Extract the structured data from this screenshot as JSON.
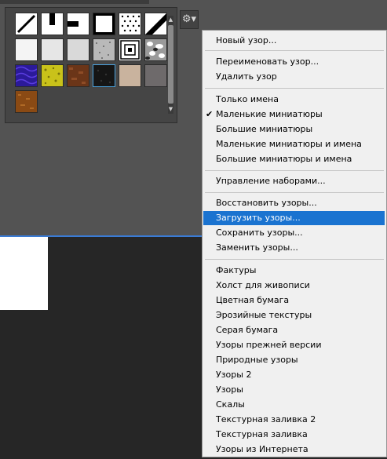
{
  "panel": {
    "gear_icon": "⚙▾",
    "scroll_up_icon": "▲",
    "scroll_down_icon": "▼"
  },
  "swatches": [
    {
      "name": "diagonal-line-pattern"
    },
    {
      "name": "vertical-bar-pattern"
    },
    {
      "name": "horizontal-bar-pattern"
    },
    {
      "name": "white-square-pattern"
    },
    {
      "name": "dot-grid-pattern"
    },
    {
      "name": "diagonal-dark-pattern"
    },
    {
      "name": "white-noise-pattern"
    },
    {
      "name": "light-gray-noise-pattern"
    },
    {
      "name": "gray-noise-pattern"
    },
    {
      "name": "dark-noise-pattern"
    },
    {
      "name": "concentric-squares-pattern"
    },
    {
      "name": "black-white-stone-pattern"
    },
    {
      "name": "blue-purple-pattern"
    },
    {
      "name": "yellow-texture-pattern"
    },
    {
      "name": "brown-texture-pattern"
    },
    {
      "name": "black-texture-pattern"
    },
    {
      "name": "beige-texture-pattern"
    },
    {
      "name": "gray-texture-pattern"
    },
    {
      "name": "orange-brown-texture-pattern"
    }
  ],
  "menu": {
    "new_pattern": "Новый узор...",
    "rename_pattern": "Переименовать узор...",
    "delete_pattern": "Удалить узор",
    "text_only": "Только имена",
    "small_thumbnails": "Маленькие миниатюры",
    "large_thumbnails": "Большие миниатюры",
    "small_list": "Маленькие миниатюры и имена",
    "large_list": "Большие миниатюры и имена",
    "preset_manager": "Управление наборами...",
    "reset_patterns": "Восстановить узоры...",
    "load_patterns": "Загрузить узоры...",
    "save_patterns": "Сохранить узоры...",
    "replace_patterns": "Заменить узоры...",
    "lib_1": "Фактуры",
    "lib_2": "Холст для живописи",
    "lib_3": "Цветная бумага",
    "lib_4": "Эрозийные текстуры",
    "lib_5": "Серая бумага",
    "lib_6": "Узоры прежней версии",
    "lib_7": "Природные узоры",
    "lib_8": "Узоры 2",
    "lib_9": "Узоры",
    "lib_10": "Скалы",
    "lib_11": "Текстурная заливка 2",
    "lib_12": "Текстурная заливка",
    "lib_13": "Узоры из Интернета",
    "check_mark": "✔"
  },
  "colors": {
    "highlight": "#1a73d0",
    "menu_bg": "#f0f0f0",
    "panel_bg": "#535353"
  }
}
